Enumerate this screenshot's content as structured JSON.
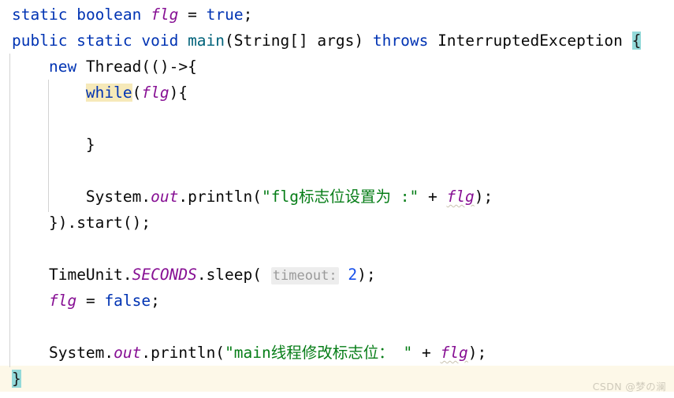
{
  "editor": {
    "kind": "java-code-editor",
    "theme": "IntelliJ Light",
    "background_color": "#ffffff",
    "current_line_color": "#fdf8e8",
    "matched_brace_color": "#93d9d9",
    "usage_highlight_color": "#f6e9b9",
    "indent_guide_color": "#d3d3d3",
    "colors": {
      "keyword": "#0033b3",
      "field": "#871094",
      "method_declaration": "#00627a",
      "string": "#067d17",
      "number": "#1750eb",
      "plain_text": "#080808",
      "inlay_hint_text": "#9a9a9a",
      "inlay_hint_background": "#ededed"
    },
    "lines": [
      {
        "n": 1,
        "text": "static boolean flg = true;",
        "tokens": [
          {
            "t": "static",
            "c": "kw"
          },
          {
            "t": " ",
            "c": "plain"
          },
          {
            "t": "boolean",
            "c": "kw"
          },
          {
            "t": " ",
            "c": "plain"
          },
          {
            "t": "flg",
            "c": "field"
          },
          {
            "t": " = ",
            "c": "plain"
          },
          {
            "t": "true",
            "c": "kw"
          },
          {
            "t": ";",
            "c": "plain"
          }
        ]
      },
      {
        "n": 2,
        "text": "public static void main(String[] args) throws InterruptedException {",
        "tokens": [
          {
            "t": "public static void ",
            "c": "kw"
          },
          {
            "t": "main",
            "c": "method"
          },
          {
            "t": "(String[] args) ",
            "c": "plain"
          },
          {
            "t": "throws",
            "c": "kw"
          },
          {
            "t": " InterruptedException ",
            "c": "plain"
          },
          {
            "t": "{",
            "c": "brace-hl"
          }
        ]
      },
      {
        "n": 3,
        "text": "    new Thread(()->{",
        "tokens": [
          {
            "t": "    ",
            "c": "pad"
          },
          {
            "t": "new",
            "c": "kw"
          },
          {
            "t": " Thread(()->{",
            "c": "plain"
          }
        ]
      },
      {
        "n": 4,
        "text": "        while(flg){",
        "tokens": [
          {
            "t": "        ",
            "c": "pad"
          },
          {
            "t": "while",
            "c": "kw-hl"
          },
          {
            "t": "(",
            "c": "plain"
          },
          {
            "t": "flg",
            "c": "field"
          },
          {
            "t": "){",
            "c": "plain"
          }
        ]
      },
      {
        "n": 5,
        "text": "",
        "tokens": []
      },
      {
        "n": 6,
        "text": "        }",
        "tokens": [
          {
            "t": "        ",
            "c": "pad"
          },
          {
            "t": "}",
            "c": "plain"
          }
        ]
      },
      {
        "n": 7,
        "text": "",
        "tokens": []
      },
      {
        "n": 8,
        "text": "        System.out.println(\"flg标志位设置为 :\" + flg);",
        "tokens": [
          {
            "t": "        ",
            "c": "pad"
          },
          {
            "t": "System.",
            "c": "plain"
          },
          {
            "t": "out",
            "c": "field"
          },
          {
            "t": ".println(",
            "c": "plain"
          },
          {
            "t": "\"flg标志位设置为 :\"",
            "c": "str"
          },
          {
            "t": " + ",
            "c": "plain"
          },
          {
            "t": "flg",
            "c": "field squiggle"
          },
          {
            "t": ");",
            "c": "plain"
          }
        ]
      },
      {
        "n": 9,
        "text": "    }).start();",
        "tokens": [
          {
            "t": "    ",
            "c": "pad"
          },
          {
            "t": "}).start();",
            "c": "plain"
          }
        ]
      },
      {
        "n": 10,
        "text": "",
        "tokens": []
      },
      {
        "n": 11,
        "text": "    TimeUnit.SECONDS.sleep( timeout: 2);",
        "tokens": [
          {
            "t": "    ",
            "c": "pad"
          },
          {
            "t": "TimeUnit.",
            "c": "plain"
          },
          {
            "t": "SECONDS",
            "c": "field"
          },
          {
            "t": ".sleep( ",
            "c": "plain"
          },
          {
            "t": "timeout:",
            "c": "param-hint"
          },
          {
            "t": " ",
            "c": "plain"
          },
          {
            "t": "2",
            "c": "num"
          },
          {
            "t": ");",
            "c": "plain"
          }
        ]
      },
      {
        "n": 12,
        "text": "    flg = false;",
        "tokens": [
          {
            "t": "    ",
            "c": "pad"
          },
          {
            "t": "flg",
            "c": "field"
          },
          {
            "t": " = ",
            "c": "plain"
          },
          {
            "t": "false",
            "c": "kw"
          },
          {
            "t": ";",
            "c": "plain"
          }
        ]
      },
      {
        "n": 13,
        "text": "",
        "tokens": []
      },
      {
        "n": 14,
        "text": "    System.out.println(\"main线程修改标志位： \" + flg);",
        "tokens": [
          {
            "t": "    ",
            "c": "pad"
          },
          {
            "t": "System.",
            "c": "plain"
          },
          {
            "t": "out",
            "c": "field"
          },
          {
            "t": ".println(",
            "c": "plain"
          },
          {
            "t": "\"main线程修改标志位： \"",
            "c": "str"
          },
          {
            "t": " + ",
            "c": "plain"
          },
          {
            "t": "flg",
            "c": "field squiggle"
          },
          {
            "t": ");",
            "c": "plain"
          }
        ]
      },
      {
        "n": 15,
        "text": "}",
        "current_line": true,
        "tokens": [
          {
            "t": "}",
            "c": "brace-hl"
          }
        ]
      }
    ]
  },
  "watermark": {
    "text": "CSDN @梦の澜"
  }
}
